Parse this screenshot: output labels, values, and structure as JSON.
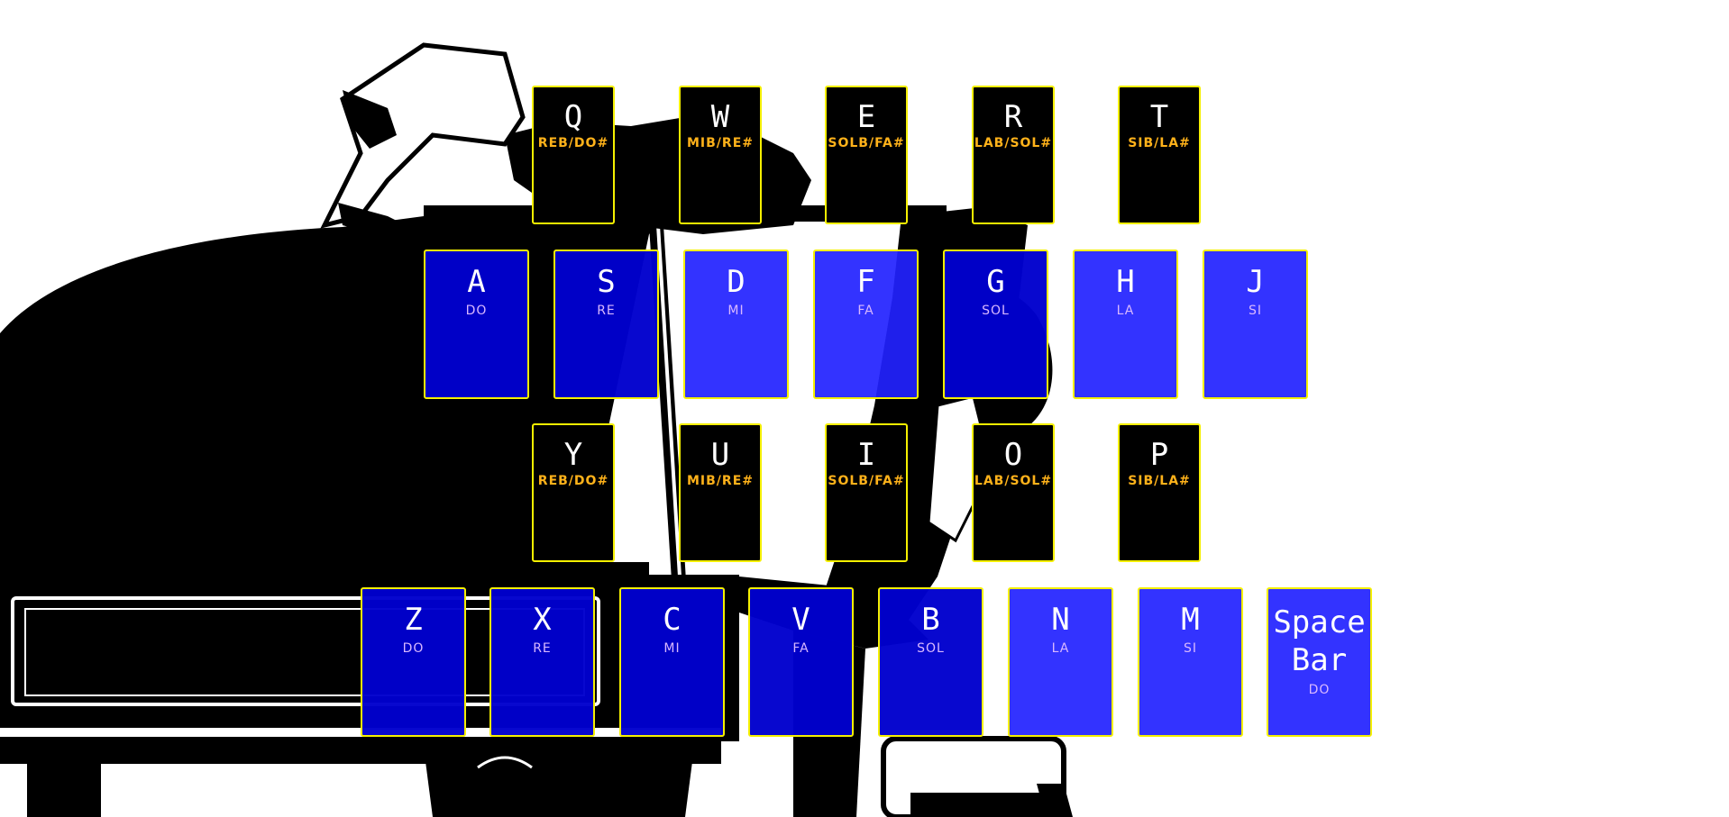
{
  "colors": {
    "key_border": "#f5f000",
    "black_key": "#000000",
    "white_key_deep": "#0000cd",
    "white_key_light": "#2222ff",
    "black_note_text": "#ffb21a",
    "white_note_text": "#d9b8ff",
    "illustration": "#000000"
  },
  "illustration": "grand-piano-with-reclining-pianist",
  "keyboard": {
    "upper_black_row": [
      {
        "key": "Q",
        "note": "REB/DO#"
      },
      {
        "key": "W",
        "note": "MIB/RE#"
      },
      {
        "key": "E",
        "note": "SOLB/FA#"
      },
      {
        "key": "R",
        "note": "LAB/SOL#"
      },
      {
        "key": "T",
        "note": "SIB/LA#"
      }
    ],
    "upper_white_row": [
      {
        "key": "A",
        "note": "DO"
      },
      {
        "key": "S",
        "note": "RE"
      },
      {
        "key": "D",
        "note": "MI"
      },
      {
        "key": "F",
        "note": "FA"
      },
      {
        "key": "G",
        "note": "SOL"
      },
      {
        "key": "H",
        "note": "LA"
      },
      {
        "key": "J",
        "note": "SI"
      }
    ],
    "lower_black_row": [
      {
        "key": "Y",
        "note": "REB/DO#"
      },
      {
        "key": "U",
        "note": "MIB/RE#"
      },
      {
        "key": "I",
        "note": "SOLB/FA#"
      },
      {
        "key": "O",
        "note": "LAB/SOL#"
      },
      {
        "key": "P",
        "note": "SIB/LA#"
      }
    ],
    "lower_white_row": [
      {
        "key": "Z",
        "note": "DO"
      },
      {
        "key": "X",
        "note": "RE"
      },
      {
        "key": "C",
        "note": "MI"
      },
      {
        "key": "V",
        "note": "FA"
      },
      {
        "key": "B",
        "note": "SOL"
      },
      {
        "key": "N",
        "note": "LA"
      },
      {
        "key": "M",
        "note": "SI"
      },
      {
        "key": "Space\nBar",
        "note": "DO"
      }
    ]
  }
}
